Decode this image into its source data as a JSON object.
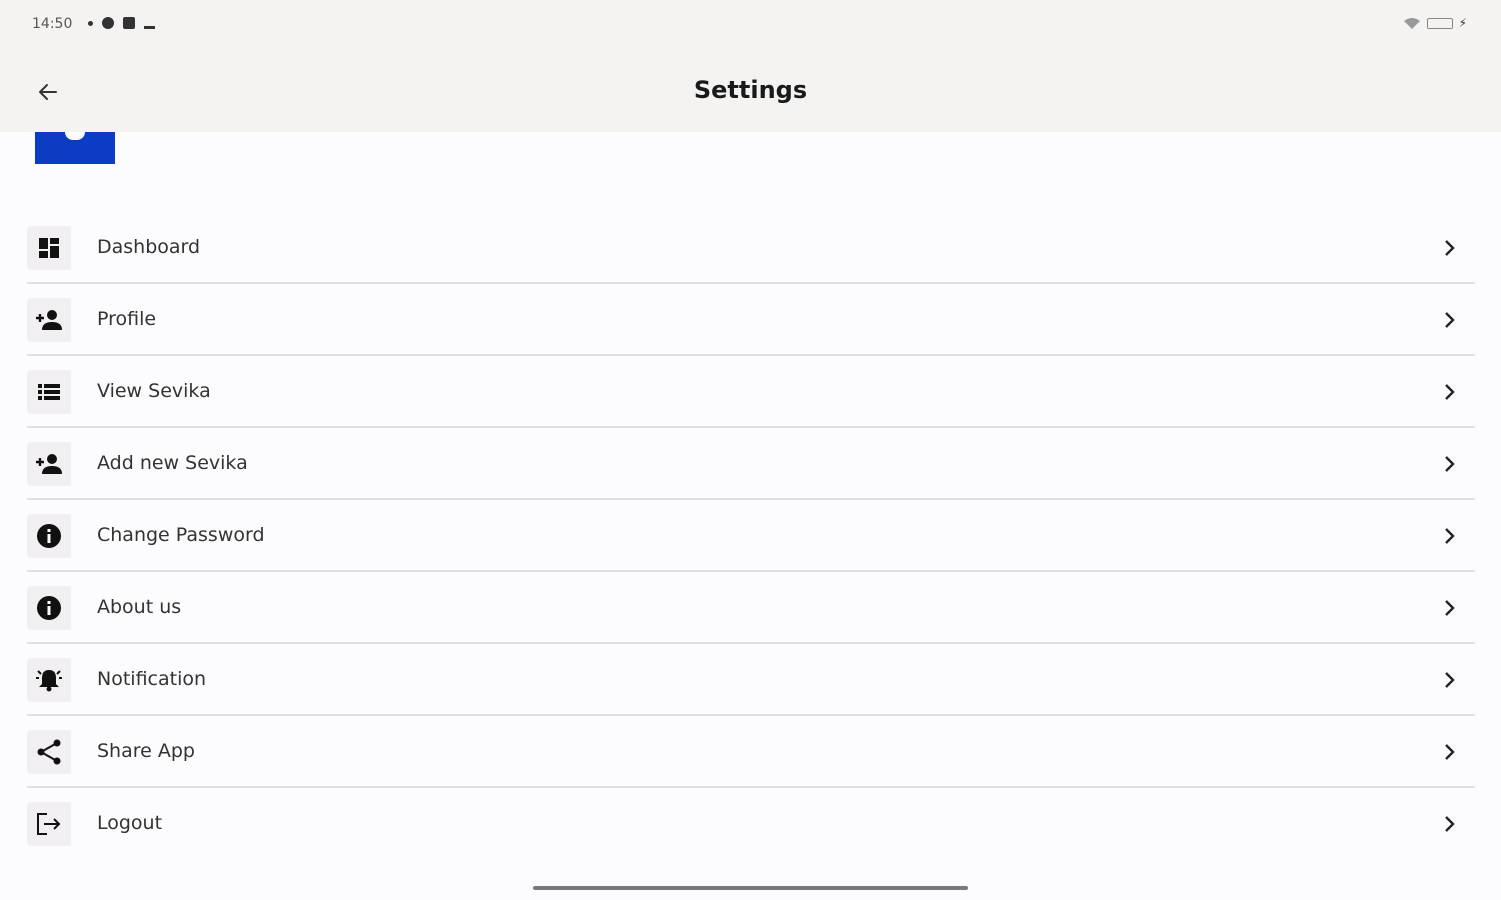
{
  "status_bar": {
    "time": "14:50"
  },
  "app_bar": {
    "title": "Settings",
    "back_icon": "arrow-left-icon"
  },
  "menu": {
    "items": [
      {
        "label": "Dashboard",
        "icon": "dashboard-icon"
      },
      {
        "label": "Profile",
        "icon": "person-add-icon"
      },
      {
        "label": "View Sevika",
        "icon": "list-icon"
      },
      {
        "label": "Add new Sevika",
        "icon": "person-add-icon"
      },
      {
        "label": "Change Password",
        "icon": "info-icon"
      },
      {
        "label": "About us",
        "icon": "info-icon"
      },
      {
        "label": "Notification",
        "icon": "bell-ring-icon"
      },
      {
        "label": "Share App",
        "icon": "share-icon"
      },
      {
        "label": "Logout",
        "icon": "logout-icon"
      }
    ]
  },
  "colors": {
    "logo_blue": "#0d3cc4",
    "background": "#fcfbfd",
    "app_bar": "#f5f3f2",
    "divider": "#e2e0e2"
  }
}
